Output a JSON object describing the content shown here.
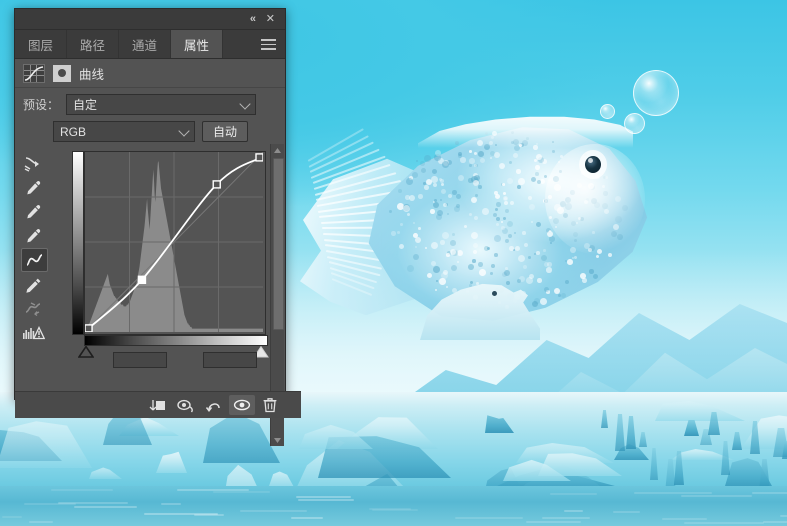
{
  "window": {
    "collapse_label": "«",
    "close_label": "✕"
  },
  "tabs": [
    {
      "label": "图层",
      "active": false
    },
    {
      "label": "路径",
      "active": false
    },
    {
      "label": "通道",
      "active": false
    },
    {
      "label": "属性",
      "active": true
    }
  ],
  "panel_menu": {
    "name": "panel-menu-icon"
  },
  "adjustment": {
    "icon": "curves-icon",
    "mask_icon": "layer-mask-thumbnail",
    "title": "曲线"
  },
  "preset": {
    "label": "预设：",
    "value": "自定"
  },
  "channel": {
    "icon": "on-image-adjust-icon",
    "value": "RGB",
    "auto_label": "自动"
  },
  "tools": [
    {
      "name": "on-image-adjustment-icon",
      "label": "在图像上修改",
      "active": false
    },
    {
      "name": "black-point-eyedropper-icon",
      "label": "设置黑场",
      "active": false
    },
    {
      "name": "gray-point-eyedropper-icon",
      "label": "设置灰场",
      "active": false
    },
    {
      "name": "white-point-eyedropper-icon",
      "label": "设置白场",
      "active": false
    },
    {
      "name": "curve-point-tool-icon",
      "label": "编辑点修改曲线",
      "active": true
    },
    {
      "name": "pencil-curve-tool-icon",
      "label": "绘制修改曲线",
      "active": false
    },
    {
      "name": "smooth-curve-icon",
      "label": "平滑曲线",
      "active": false
    },
    {
      "name": "clipping-warning-icon",
      "label": "显示剪切",
      "active": false
    }
  ],
  "footer_buttons": [
    {
      "name": "clip-to-layer-icon",
      "label": "此调整剪贴到此图层",
      "active": false
    },
    {
      "name": "view-previous-state-icon",
      "label": "查看上一状态",
      "active": false
    },
    {
      "name": "reset-icon",
      "label": "复位",
      "active": false
    },
    {
      "name": "toggle-visibility-icon",
      "label": "切换图层可见性",
      "active": true
    },
    {
      "name": "delete-icon",
      "label": "删除此调整图层",
      "active": false
    }
  ],
  "curve": {
    "points": [
      {
        "x": 0.02,
        "y": 0.02
      },
      {
        "x": 0.32,
        "y": 0.29
      },
      {
        "x": 0.74,
        "y": 0.82
      },
      {
        "x": 0.99,
        "y": 0.97
      }
    ],
    "grid_divisions": 4,
    "black_slider": 0.0,
    "white_slider": 1.0,
    "histogram": [
      2,
      2,
      3,
      3,
      4,
      4,
      5,
      5,
      6,
      7,
      8,
      9,
      10,
      11,
      12,
      13,
      14,
      15,
      16,
      17,
      18,
      19,
      20,
      21,
      22,
      23,
      24,
      25,
      26,
      27,
      28,
      29,
      30,
      31,
      32,
      33,
      34,
      32,
      30,
      28,
      27,
      26,
      25,
      24,
      23,
      22,
      21,
      21,
      20,
      20,
      19,
      19,
      18,
      18,
      17,
      17,
      17,
      16,
      16,
      16,
      16,
      15,
      15,
      15,
      15,
      15,
      16,
      16,
      16,
      17,
      17,
      18,
      19,
      20,
      21,
      22,
      23,
      24,
      25,
      26,
      27,
      28,
      30,
      32,
      34,
      36,
      38,
      41,
      44,
      47,
      50,
      53,
      56,
      59,
      62,
      66,
      70,
      74,
      78,
      72,
      68,
      64,
      60,
      66,
      72,
      78,
      84,
      90,
      95,
      88,
      80,
      76,
      82,
      88,
      94,
      99,
      100,
      96,
      92,
      88,
      84,
      82,
      80,
      78,
      76,
      74,
      72,
      70,
      68,
      66,
      64,
      62,
      60,
      58,
      56,
      54,
      52,
      50,
      48,
      46,
      44,
      42,
      40,
      38,
      36,
      34,
      32,
      30,
      28,
      26,
      24,
      22,
      20,
      18,
      16,
      14,
      12,
      10,
      9,
      8,
      7,
      6,
      5,
      5,
      4,
      4,
      3,
      3,
      3,
      2,
      2,
      2,
      2,
      2,
      2,
      2,
      2,
      2,
      2,
      2,
      2,
      2,
      2,
      2,
      2,
      2,
      2,
      2,
      2,
      2,
      2,
      2,
      2,
      2,
      2,
      2,
      2,
      2,
      2,
      2,
      2,
      2,
      2,
      2,
      2,
      2,
      2,
      2,
      2,
      2,
      2,
      2,
      2,
      2,
      2,
      2,
      2,
      2,
      2,
      2,
      2,
      2,
      2,
      2,
      2,
      2,
      2,
      2,
      2,
      2,
      2,
      2,
      2,
      2,
      2,
      2,
      2,
      2,
      2,
      2,
      2,
      2,
      2,
      2,
      2,
      2,
      2,
      2,
      2,
      2,
      2,
      2,
      2,
      2,
      2,
      2,
      2,
      2,
      2,
      2,
      2,
      2,
      2,
      2,
      2,
      2,
      2,
      2,
      2,
      2,
      2,
      2,
      2,
      2,
      2,
      2,
      2,
      2,
      2,
      2,
      2,
      2
    ]
  },
  "colors": {
    "panel_bg": "#535353",
    "panel_header": "#3b3b3b",
    "accent": "#ececec",
    "canvas_sky": "#3cc5e5",
    "ice": "#a8e2ef"
  }
}
